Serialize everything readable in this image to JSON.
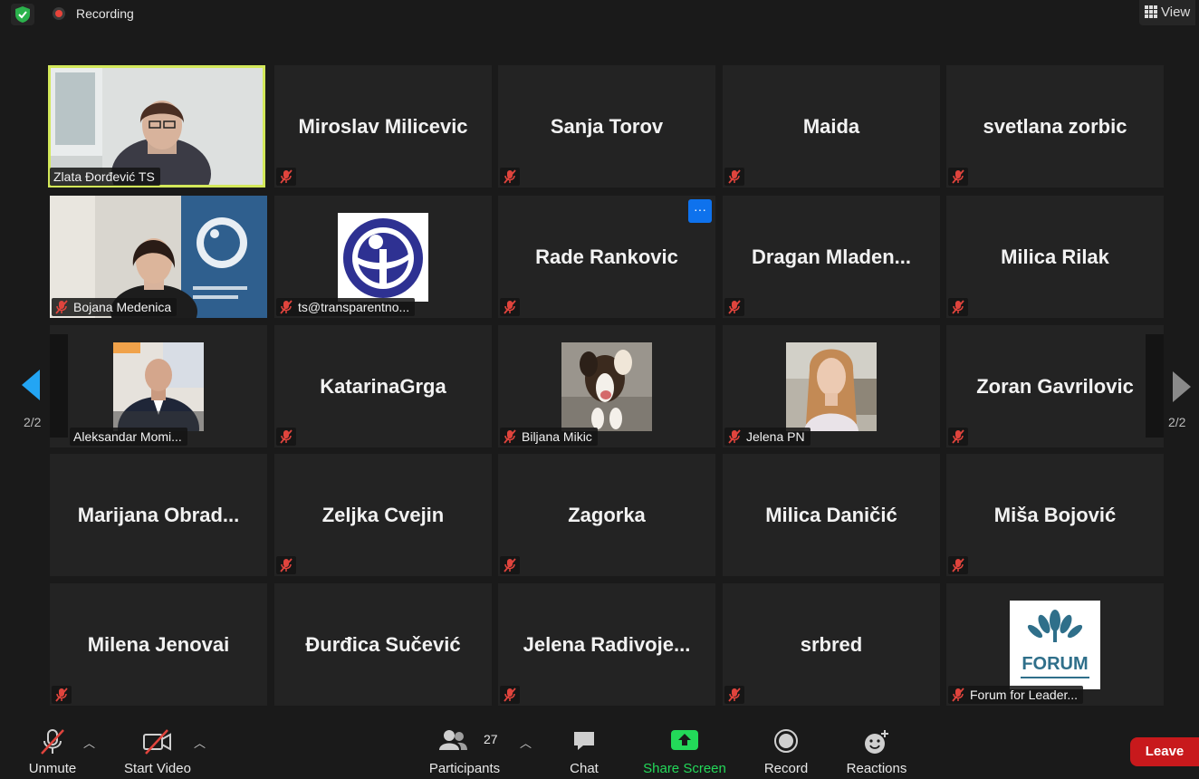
{
  "topbar": {
    "recording_label": "Recording",
    "view_label": "View"
  },
  "tiles": [
    {
      "type": "video",
      "label": "Zlata Đorđević TS"
    },
    {
      "type": "name",
      "label": "Miroslav Milicevic"
    },
    {
      "type": "name",
      "label": "Sanja Torov"
    },
    {
      "type": "name",
      "label": "Maida"
    },
    {
      "type": "name",
      "label": "svetlana zorbic"
    },
    {
      "type": "video",
      "label": "Bojana Medenica"
    },
    {
      "type": "avatar",
      "label": "ts@transparentno..."
    },
    {
      "type": "name",
      "label": "Rade Rankovic",
      "more_label": "···"
    },
    {
      "type": "name",
      "label": "Dragan  Mladen..."
    },
    {
      "type": "name",
      "label": "Milica Rilak"
    },
    {
      "type": "avatar",
      "label": "Aleksandar Momi..."
    },
    {
      "type": "name",
      "label": "KatarinaGrga"
    },
    {
      "type": "avatar",
      "label": "Biljana Mikic"
    },
    {
      "type": "avatar",
      "label": "Jelena PN"
    },
    {
      "type": "name",
      "label": "Zoran Gavrilovic"
    },
    {
      "type": "name",
      "label": "Marijana  Obrad..."
    },
    {
      "type": "name",
      "label": "Zeljka Cvejin"
    },
    {
      "type": "name",
      "label": "Zagorka"
    },
    {
      "type": "name",
      "label": "Milica Daničić"
    },
    {
      "type": "name",
      "label": "Miša Bojović"
    },
    {
      "type": "name",
      "label": "Milena Jenovai"
    },
    {
      "type": "name",
      "label": "Đurđica Sučević"
    },
    {
      "type": "name",
      "label": "Jelena  Radivoje..."
    },
    {
      "type": "name",
      "label": "srbred"
    },
    {
      "type": "avatar",
      "label": "Forum for Leader...",
      "logo_text": "FORUM"
    }
  ],
  "pagination": {
    "left_page": "2/2",
    "right_page": "2/2"
  },
  "toolbar": {
    "unmute": "Unmute",
    "start_video": "Start Video",
    "participants": "Participants",
    "participants_count": "27",
    "chat": "Chat",
    "share_screen": "Share Screen",
    "record": "Record",
    "reactions": "Reactions",
    "leave": "Leave"
  },
  "colors": {
    "active_speaker": "#d3e85a",
    "share_green": "#23d959",
    "leave_red": "#c8191c",
    "mute_red": "#e0443d",
    "accent_blue": "#0e72ed"
  }
}
